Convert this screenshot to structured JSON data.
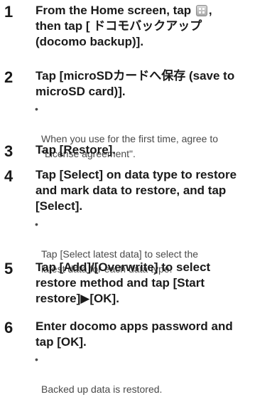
{
  "steps": [
    {
      "number": "1",
      "title_before_icon": "From the Home screen, tap ",
      "icon": "apps-grid-icon",
      "title_after_icon": ",\nthen tap [ ドコモバックアップ\n(docomo backup)]."
    },
    {
      "number": "2",
      "title": "Tap [microSDカードへ保存 (save to\nmicroSD card)].",
      "note": "When you use for the first time, agree to\n\"License agreement\"."
    },
    {
      "number": "3",
      "title": "Tap [Restore]."
    },
    {
      "number": "4",
      "title": "Tap [Select] on data type to restore\nand mark data to restore, and tap\n[Select].",
      "note": "Tap [Select latest data] to select the\nlatest data for each data type."
    },
    {
      "number": "5",
      "title": "Tap [Add]/[Overwrite] to select\nrestore method and tap [Start\nrestore]▶[OK]."
    },
    {
      "number": "6",
      "title": "Enter docomo apps password and\ntap [OK].",
      "note": "Backed up data is restored."
    }
  ],
  "bullet_glyph": "•"
}
